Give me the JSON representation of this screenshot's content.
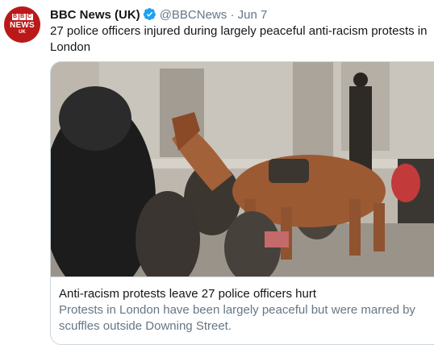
{
  "tweet": {
    "author_name": "BBC News (UK)",
    "handle": "@BBCNews",
    "separator": "·",
    "date": "Jun 7",
    "text": "27 police officers injured during largely peaceful anti-racism protests in London",
    "avatar": {
      "logo_letters": [
        "B",
        "B",
        "C"
      ],
      "logo_word": "NEWS",
      "logo_region": "UK",
      "color": "#bb1919"
    },
    "verified_icon": "verified-badge-icon",
    "verified_color": "#1da1f2"
  },
  "card": {
    "title": "Anti-racism protests leave 27 police officers hurt",
    "description": "Protests in London have been largely peaceful but were marred by scuffles outside Downing Street."
  }
}
